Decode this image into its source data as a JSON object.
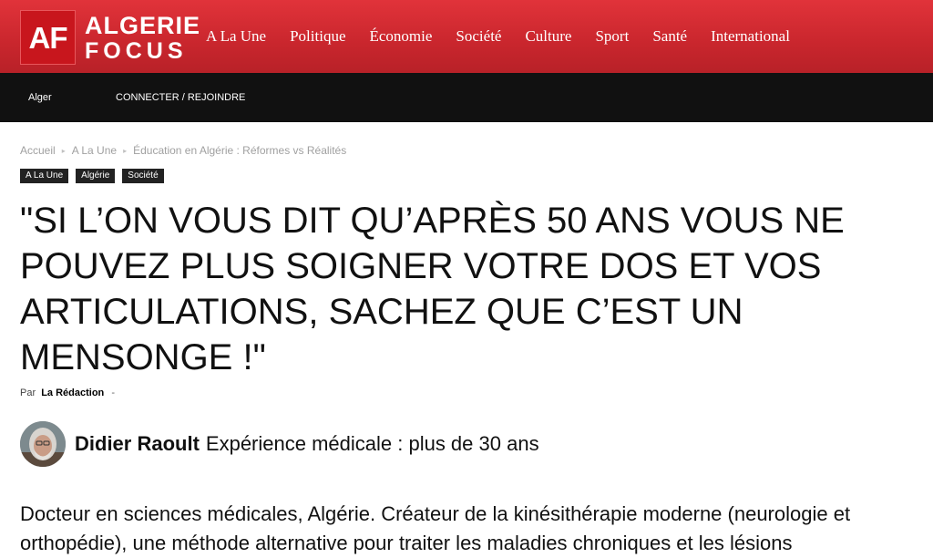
{
  "brand": {
    "badge": "AF",
    "word1": "ALGERIE",
    "word2": "FOCUS",
    "primary_color": "#d32f35",
    "dark_bar_color": "#111111"
  },
  "nav": {
    "items": [
      "A La Une",
      "Politique",
      "Économie",
      "Société",
      "Culture",
      "Sport",
      "Santé",
      "International"
    ]
  },
  "subbar": {
    "city": "Alger",
    "connect_label": "CONNECTER / REJOINDRE"
  },
  "breadcrumb": {
    "items": [
      "Accueil",
      "A La Une",
      "Éducation en Algérie : Réformes vs Réalités"
    ]
  },
  "tags": [
    "A La Une",
    "Algérie",
    "Société"
  ],
  "article": {
    "title": "\"SI L’ON VOUS DIT QU’APRÈS 50 ANS VOUS NE POUVEZ PLUS SOIGNER VOTRE DOS ET VOS ARTICULATIONS, SACHEZ QUE C’EST UN MENSONGE !\"",
    "by_prefix": "Par",
    "author": "La Rédaction",
    "by_suffix": "-",
    "expert": {
      "name": "Didier Raoult",
      "role": "Expérience médicale : plus de 30 ans",
      "avatar_icon": "person-portrait-icon"
    },
    "body": "Docteur en sciences médicales, Algérie. Créateur de la kinésithérapie moderne (neurologie et orthopédie), une méthode alternative pour traiter les maladies chroniques et les lésions"
  }
}
